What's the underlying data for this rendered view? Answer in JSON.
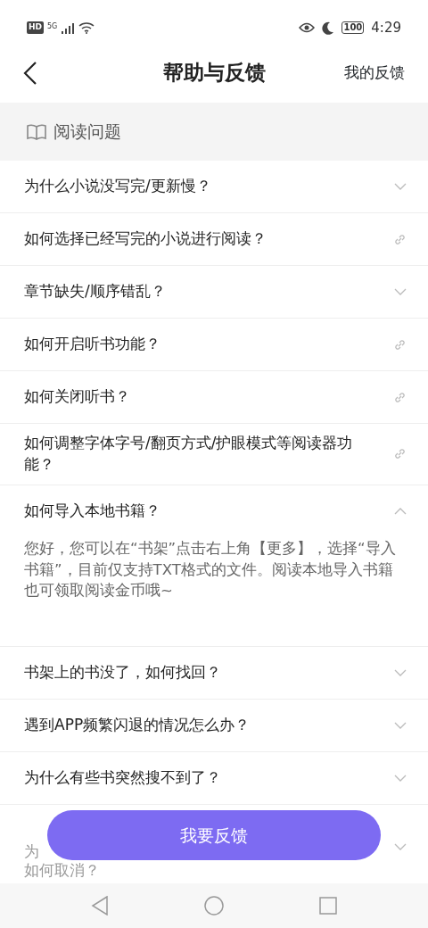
{
  "status_bar": {
    "left": "HD",
    "network": "5G",
    "time": "4:29",
    "battery": "100"
  },
  "header": {
    "title": "帮助与反馈",
    "action": "我的反馈"
  },
  "section": {
    "title": "阅读问题"
  },
  "questions": [
    {
      "text": "为什么小说没写完/更新慢？",
      "kind": "expand",
      "expanded": false
    },
    {
      "text": "如何选择已经写完的小说进行阅读？",
      "kind": "link"
    },
    {
      "text": "章节缺失/顺序错乱？",
      "kind": "expand",
      "expanded": false
    },
    {
      "text": "如何开启听书功能？",
      "kind": "link"
    },
    {
      "text": "如何关闭听书？",
      "kind": "link"
    },
    {
      "text": "如何调整字体字号/翻页方式/护眼模式等阅读器功能？",
      "kind": "link"
    },
    {
      "text": "如何导入本地书籍？",
      "kind": "expand",
      "expanded": true,
      "answer": "您好，您可以在“书架”点击右上角【更多】，选择“导入书籍”，目前仅支持TXT格式的文件。阅读本地导入书籍也可领取阅读金币哦~"
    },
    {
      "text": "书架上的书没了，如何找回？",
      "kind": "expand",
      "expanded": false
    },
    {
      "text": "遇到APP频繁闪退的情况怎么办？",
      "kind": "expand",
      "expanded": false
    },
    {
      "text": "为什么有些书突然搜不到了？",
      "kind": "expand",
      "expanded": false
    },
    {
      "text": "为",
      "text_line_2": "如何取消？",
      "kind": "expand",
      "expanded": false,
      "covered": true
    }
  ],
  "feedback_button": "我要反馈"
}
